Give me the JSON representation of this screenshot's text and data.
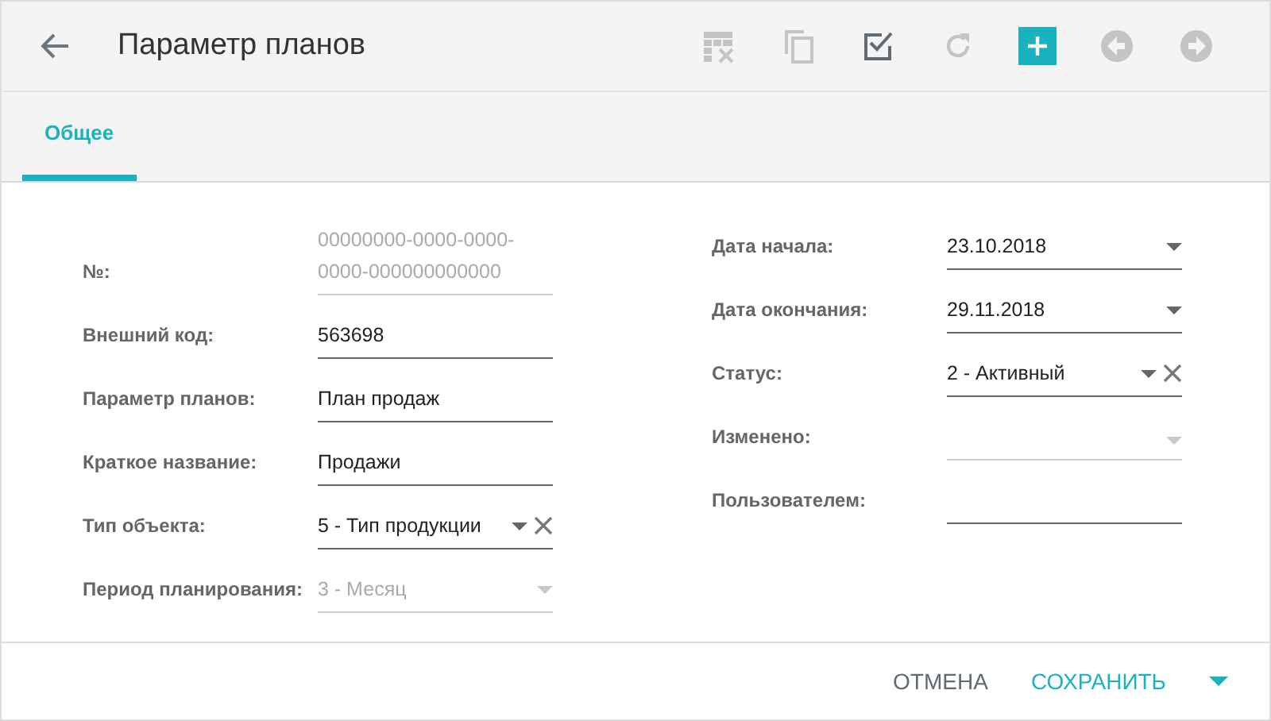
{
  "header": {
    "title": "Параметр планов"
  },
  "toolbar": [
    {
      "kind": "grid-delete",
      "disabled": true
    },
    {
      "kind": "copy",
      "disabled": true
    },
    {
      "kind": "check",
      "disabled": false
    },
    {
      "kind": "refresh",
      "disabled": true
    },
    {
      "kind": "add",
      "disabled": false
    },
    {
      "kind": "prev",
      "disabled": true
    },
    {
      "kind": "next",
      "disabled": true
    }
  ],
  "tabs": [
    {
      "label": "Общее",
      "selected": true
    }
  ],
  "left_fields": [
    {
      "label": "№:",
      "value": "00000000-0000-0000-0000-000000000000",
      "kind": "text",
      "disabled": true,
      "clearable": false
    },
    {
      "label": "Внешний код:",
      "value": "563698",
      "kind": "text",
      "disabled": false,
      "clearable": false
    },
    {
      "label": "Параметр планов:",
      "value": "План продаж",
      "kind": "text",
      "disabled": false,
      "clearable": false
    },
    {
      "label": "Краткое название:",
      "value": "Продажи",
      "kind": "text",
      "disabled": false,
      "clearable": false
    },
    {
      "label": "Тип объекта:",
      "value": "5 - Тип продукции",
      "kind": "select",
      "disabled": false,
      "clearable": true
    },
    {
      "label": "Период планирования:",
      "value": "3 - Месяц",
      "kind": "select",
      "disabled": true,
      "clearable": false
    }
  ],
  "right_fields": [
    {
      "label": "Дата начала:",
      "value": "23.10.2018",
      "kind": "select",
      "disabled": false,
      "clearable": false
    },
    {
      "label": "Дата окончания:",
      "value": "29.11.2018",
      "kind": "select",
      "disabled": false,
      "clearable": false
    },
    {
      "label": "Статус:",
      "value": "2 - Активный",
      "kind": "select",
      "disabled": false,
      "clearable": true
    },
    {
      "label": "Изменено:",
      "kind": "select",
      "disabled": true,
      "clearable": false
    },
    {
      "label": "Пользователем:",
      "kind": "text",
      "disabled": false,
      "clearable": false
    }
  ],
  "footer": {
    "cancel": "ОТМЕНА",
    "save": "СОХРАНИТЬ"
  }
}
